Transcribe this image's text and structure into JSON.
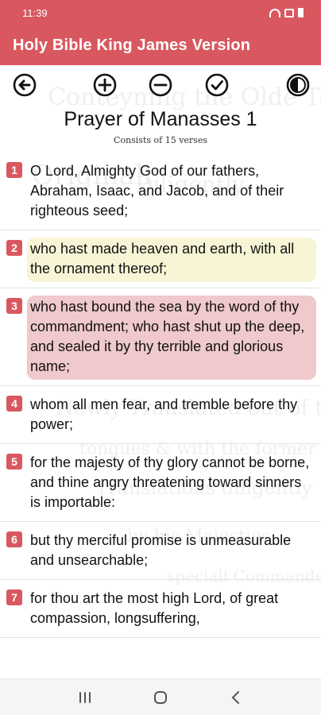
{
  "status_bar": {
    "time": "11:39",
    "icons": [
      "wifi-icon",
      "sim-icon",
      "battery-icon"
    ]
  },
  "app_bar": {
    "title": "Holy Bible King James Version",
    "color": "#d9585f"
  },
  "toolbar": {
    "icons": [
      "back-arrow-icon",
      "zoom-in-icon",
      "zoom-out-icon",
      "check-circle-icon",
      "contrast-icon"
    ]
  },
  "chapter": {
    "title": "Prayer of Manasses 1",
    "subtitle": "Consists of 15 verses"
  },
  "verses": [
    {
      "num": "1",
      "text": "O Lord, Almighty God of our fathers, Abraham, Isaac, and Jacob, and of their righteous seed;",
      "highlight": "none"
    },
    {
      "num": "2",
      "text": "who hast made heaven and earth, with all the ornament thereof;",
      "highlight": "yellow"
    },
    {
      "num": "3",
      "text": "who hast bound the sea by the word of thy commandment; who hast shut up the deep, and sealed it by thy terrible and glorious name;",
      "highlight": "red"
    },
    {
      "num": "4",
      "text": "whom all men fear, and tremble before thy power;",
      "highlight": "none"
    },
    {
      "num": "5",
      "text": "for the majesty of thy glory cannot be borne, and thine angry threatening toward sinners is importable:",
      "highlight": "none"
    },
    {
      "num": "6",
      "text": "but thy merciful promise is unmeasurable and unsearchable;",
      "highlight": "none"
    },
    {
      "num": "7",
      "text": "for thou art the most high Lord, of great compassion, longsuffering,",
      "highlight": "none"
    }
  ],
  "colors": {
    "accent": "#d9585f",
    "highlight_yellow": "#f8f5d7",
    "highlight_red": "#efc9cb"
  },
  "nav_bar": {
    "icons": [
      "recent-apps-icon",
      "home-icon",
      "back-icon"
    ]
  }
}
